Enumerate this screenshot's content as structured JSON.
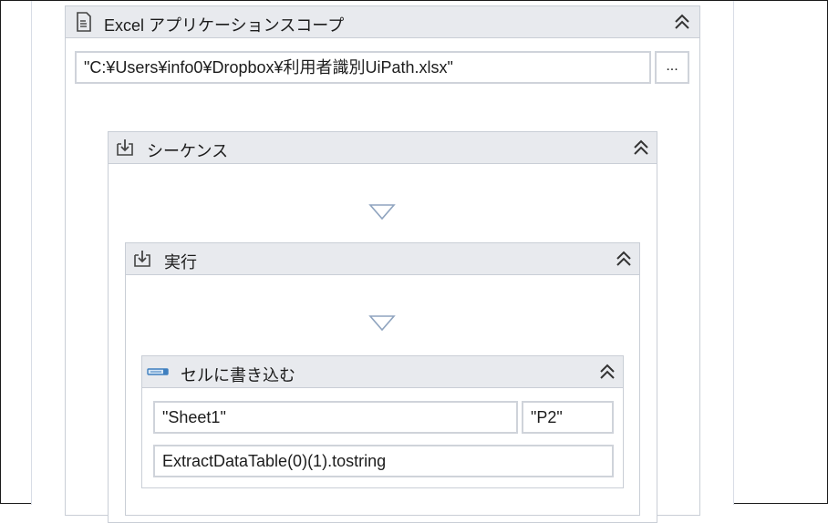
{
  "excel_scope": {
    "title": "Excel アプリケーションスコープ",
    "workbook_path": "\"C:¥Users¥info0¥Dropbox¥利用者識別UiPath.xlsx\"",
    "browse_label": "..."
  },
  "sequence": {
    "title": "シーケンス"
  },
  "execute": {
    "title": "実行"
  },
  "write_cell": {
    "title": "セルに書き込む",
    "sheet_value": "\"Sheet1\"",
    "range_value": "\"P2\"",
    "value_expression": "ExtractDataTable(0)(1).tostring"
  },
  "colors": {
    "header_bg": "#e8eaee",
    "border": "#c9ced6",
    "drop_arrow": "#8fa4bf"
  }
}
